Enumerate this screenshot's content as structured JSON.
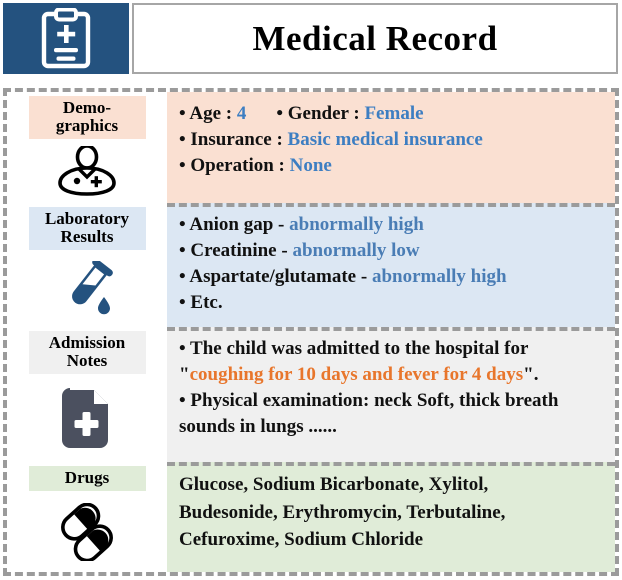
{
  "header": {
    "title": "Medical Record",
    "icon": "clipboard-medical-icon",
    "icon_bg": "#24527f"
  },
  "colors": {
    "demographics_bg": "#fae0d2",
    "laboratory_bg": "#dce7f3",
    "notes_bg": "#f0f0f0",
    "drugs_bg": "#e0ecd8",
    "value_blue": "#4a7db5",
    "highlight_orange": "#e8762c",
    "frame_dash": "#9b9b9b"
  },
  "sections": {
    "demographics": {
      "label": "Demo-\ngraphics",
      "label_line1": "Demo-",
      "label_line2": "graphics",
      "icon": "patient-person-icon",
      "fields": {
        "age_label": "• Age :",
        "age_value": "4",
        "gender_label": "• Gender :",
        "gender_value": "Female",
        "insurance_label": "• Insurance :",
        "insurance_value": "Basic medical insurance",
        "operation_label": "• Operation :",
        "operation_value": "None"
      }
    },
    "laboratory": {
      "label_line1": "Laboratory",
      "label_line2": "Results",
      "icon": "test-tube-icon",
      "results": [
        {
          "bullet": "•",
          "name": "Anion gap -",
          "status": "abnormally high"
        },
        {
          "bullet": "•",
          "name": "Creatinine -",
          "status": "abnormally low"
        },
        {
          "bullet": "•",
          "name": "Aspartate/glutamate -",
          "status": "abnormally high"
        },
        {
          "bullet": "•",
          "name": "Etc.",
          "status": ""
        }
      ]
    },
    "notes": {
      "label_line1": "Admission",
      "label_line2": "Notes",
      "icon": "document-plus-icon",
      "line1_prefix": "• The child was admitted to the hospital for",
      "quote_open": "\"",
      "quote_text": "coughing for 10 days and fever for 4 days",
      "quote_close": "\".",
      "line2": "• Physical examination: neck Soft, thick breath sounds in lungs ......"
    },
    "drugs": {
      "label": "Drugs",
      "icon": "pills-capsules-icon",
      "line1": "Glucose, Sodium Bicarbonate, Xylitol,",
      "line2": "Budesonide, Erythromycin, Terbutaline,",
      "line3": "Cefuroxime, Sodium Chloride"
    }
  }
}
